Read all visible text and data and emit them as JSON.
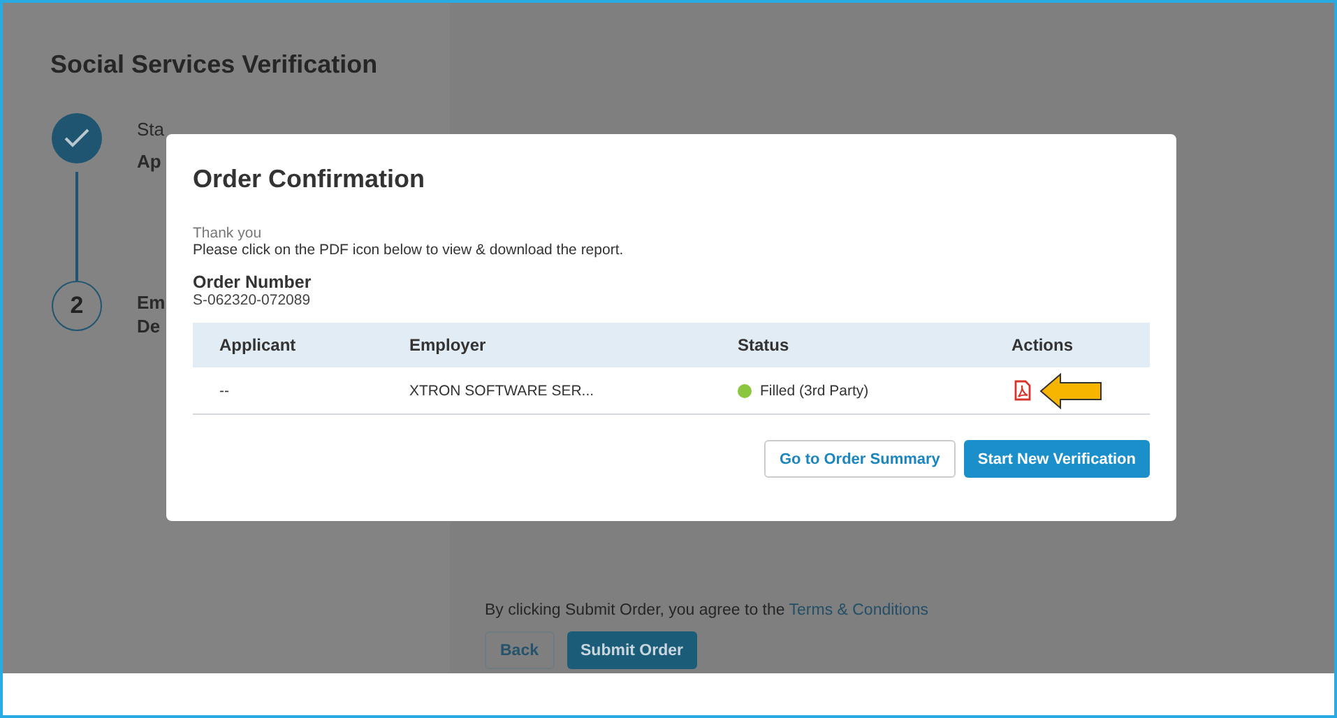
{
  "page": {
    "title": "Social Services Verification"
  },
  "steps": [
    {
      "kind": "done",
      "label": "Sta",
      "detail": "Ap"
    },
    {
      "kind": "pending",
      "number": "2",
      "label": "Em",
      "detail": "De"
    }
  ],
  "terms": {
    "text": "By clicking Submit Order, you agree to the",
    "link": "Terms & Conditions"
  },
  "form_buttons": [
    {
      "label": "Back",
      "kind": "secondary"
    },
    {
      "label": "Submit Order",
      "kind": "primary"
    }
  ],
  "dialog": {
    "title": "Order Confirmation",
    "thanks": "Thank you",
    "instruction": "Please click on the PDF icon below to view & download the report.",
    "order_number_label": "Order Number",
    "order_number": "S-062320-072089",
    "table": {
      "columns": [
        "Applicant",
        "Employer",
        "Status",
        "Actions"
      ],
      "rows": [
        {
          "applicant": "--",
          "employer": "XTRON SOFTWARE SER...",
          "status": "Filled (3rd Party)",
          "color": "#8cc63f",
          "kind": "pdf",
          "highlighted": true
        }
      ]
    },
    "buttons": [
      {
        "label": "Go to Order Summary",
        "kind": "secondary"
      },
      {
        "label": "Start New Verification",
        "kind": "primary"
      }
    ]
  }
}
